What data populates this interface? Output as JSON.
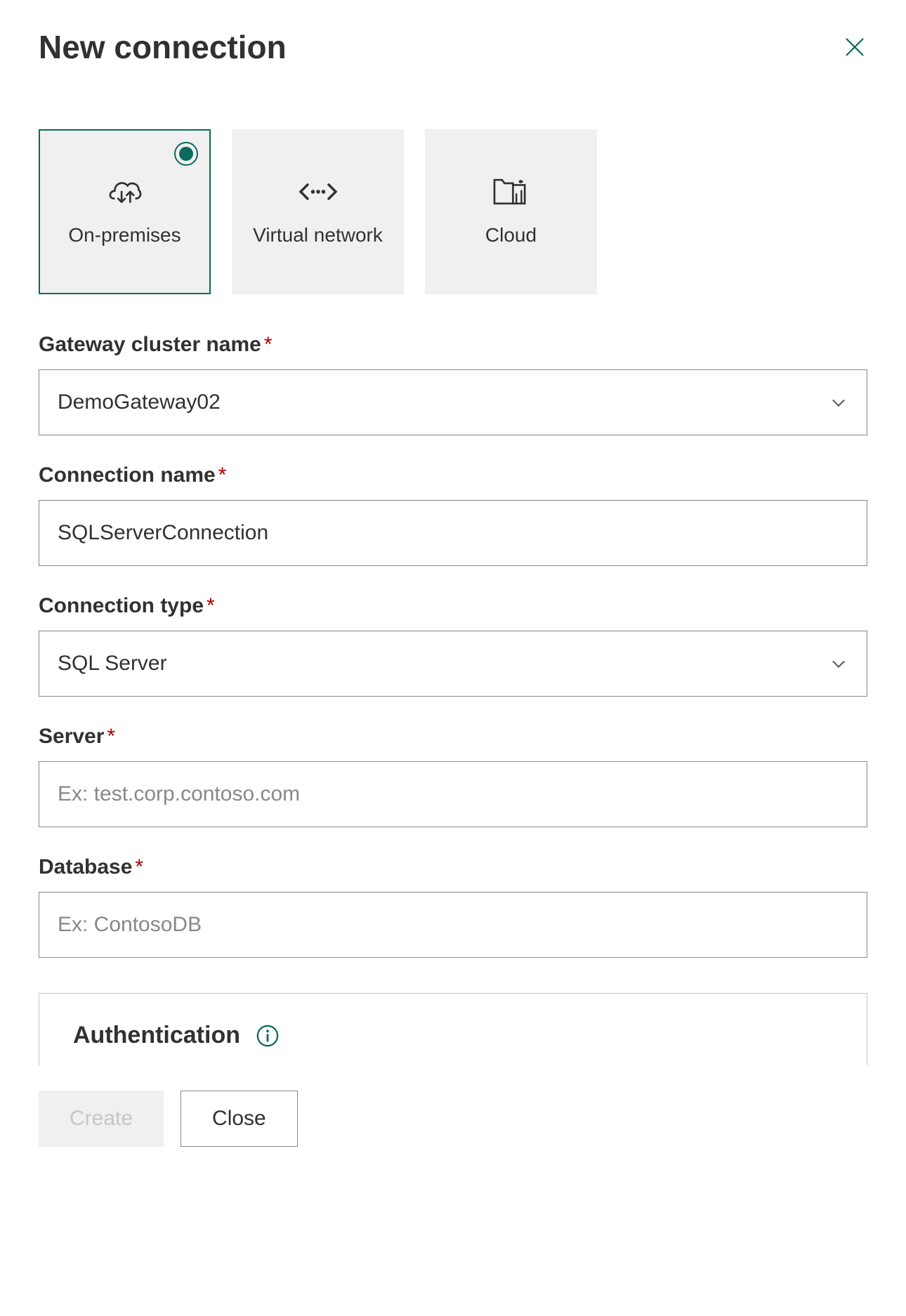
{
  "header": {
    "title": "New connection"
  },
  "cards": {
    "on_premises": "On-premises",
    "virtual_network": "Virtual network",
    "cloud": "Cloud"
  },
  "fields": {
    "gateway": {
      "label": "Gateway cluster name",
      "value": "DemoGateway02"
    },
    "connection_name": {
      "label": "Connection name",
      "value": "SQLServerConnection"
    },
    "connection_type": {
      "label": "Connection type",
      "value": "SQL Server"
    },
    "server": {
      "label": "Server",
      "placeholder": "Ex: test.corp.contoso.com",
      "value": ""
    },
    "database": {
      "label": "Database",
      "placeholder": "Ex: ContosoDB",
      "value": ""
    }
  },
  "auth": {
    "title": "Authentication"
  },
  "buttons": {
    "create": "Create",
    "close": "Close"
  },
  "required_marker": "*"
}
